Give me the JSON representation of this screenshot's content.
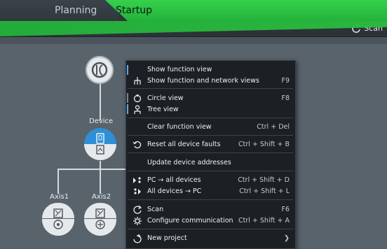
{
  "tabs": {
    "planning": "Planning",
    "startup": "Startup"
  },
  "toolbar": {
    "scan_label": "Scan"
  },
  "tree": {
    "device_label": "Device",
    "axis1_label": "Axis1",
    "axis2_label": "Axis2"
  },
  "menu": {
    "items": [
      {
        "label": "Show function view",
        "shortcut": ""
      },
      {
        "label": "Show function and network views",
        "shortcut": "F9"
      },
      {
        "label": "Circle view",
        "shortcut": "F8"
      },
      {
        "label": "Tree view",
        "shortcut": ""
      },
      {
        "label": "Clear function view",
        "shortcut": "Ctrl + Del"
      },
      {
        "label": "Reset all device faults",
        "shortcut": "Ctrl + Shift + B"
      },
      {
        "label": "Update device addresses",
        "shortcut": ""
      },
      {
        "label": "PC → all devices",
        "shortcut": "Ctrl + Shift + D"
      },
      {
        "label": "All devices → PC",
        "shortcut": "Ctrl + Shift + L"
      },
      {
        "label": "Scan",
        "shortcut": "F6"
      },
      {
        "label": "Configure communication",
        "shortcut": "Ctrl + Shift + A"
      },
      {
        "label": "New project",
        "shortcut": "❯"
      }
    ]
  },
  "colors": {
    "accent_green": "#2bbd3f",
    "accent_blue": "#2f8fd6",
    "menu_bg": "#1c2024"
  }
}
